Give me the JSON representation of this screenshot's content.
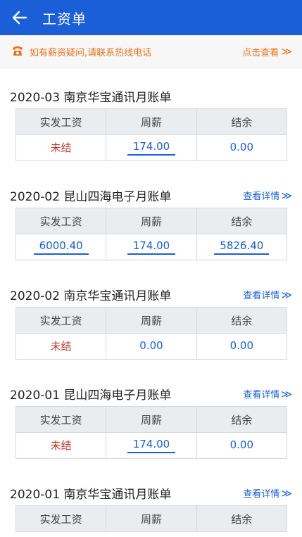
{
  "header": {
    "title": "工资单"
  },
  "notice": {
    "text": "如有薪资疑问,请联系热线电话",
    "link_label": "点击查看",
    "link_arrow": "≫",
    "accent": "#e8731a"
  },
  "table_headers": {
    "actual_pay": "实发工资",
    "weekly_pay": "周薪",
    "balance": "结余"
  },
  "detail_label": "查看详情",
  "detail_arrow": "≫",
  "bills": [
    {
      "title": "2020-03 南京华宝通讯月账单",
      "actual_pay": "未结",
      "weekly_pay": "174.00",
      "balance": "0.00"
    },
    {
      "title": "2020-02 昆山四海电子月账单",
      "actual_pay": "6000.40",
      "weekly_pay": "174.00",
      "balance": "5826.40"
    },
    {
      "title": "2020-02 南京华宝通讯月账单",
      "actual_pay": "未结",
      "weekly_pay": "0.00",
      "balance": "0.00"
    },
    {
      "title": "2020-01 昆山四海电子月账单",
      "actual_pay": "未结",
      "weekly_pay": "174.00",
      "balance": "0.00"
    },
    {
      "title": "2020-01 南京华宝通讯月账单",
      "actual_pay": "",
      "weekly_pay": "",
      "balance": ""
    }
  ],
  "colors": {
    "primary": "#1a5fd8",
    "unsettled": "#c0392b",
    "table_header_bg": "#eaedf0"
  }
}
